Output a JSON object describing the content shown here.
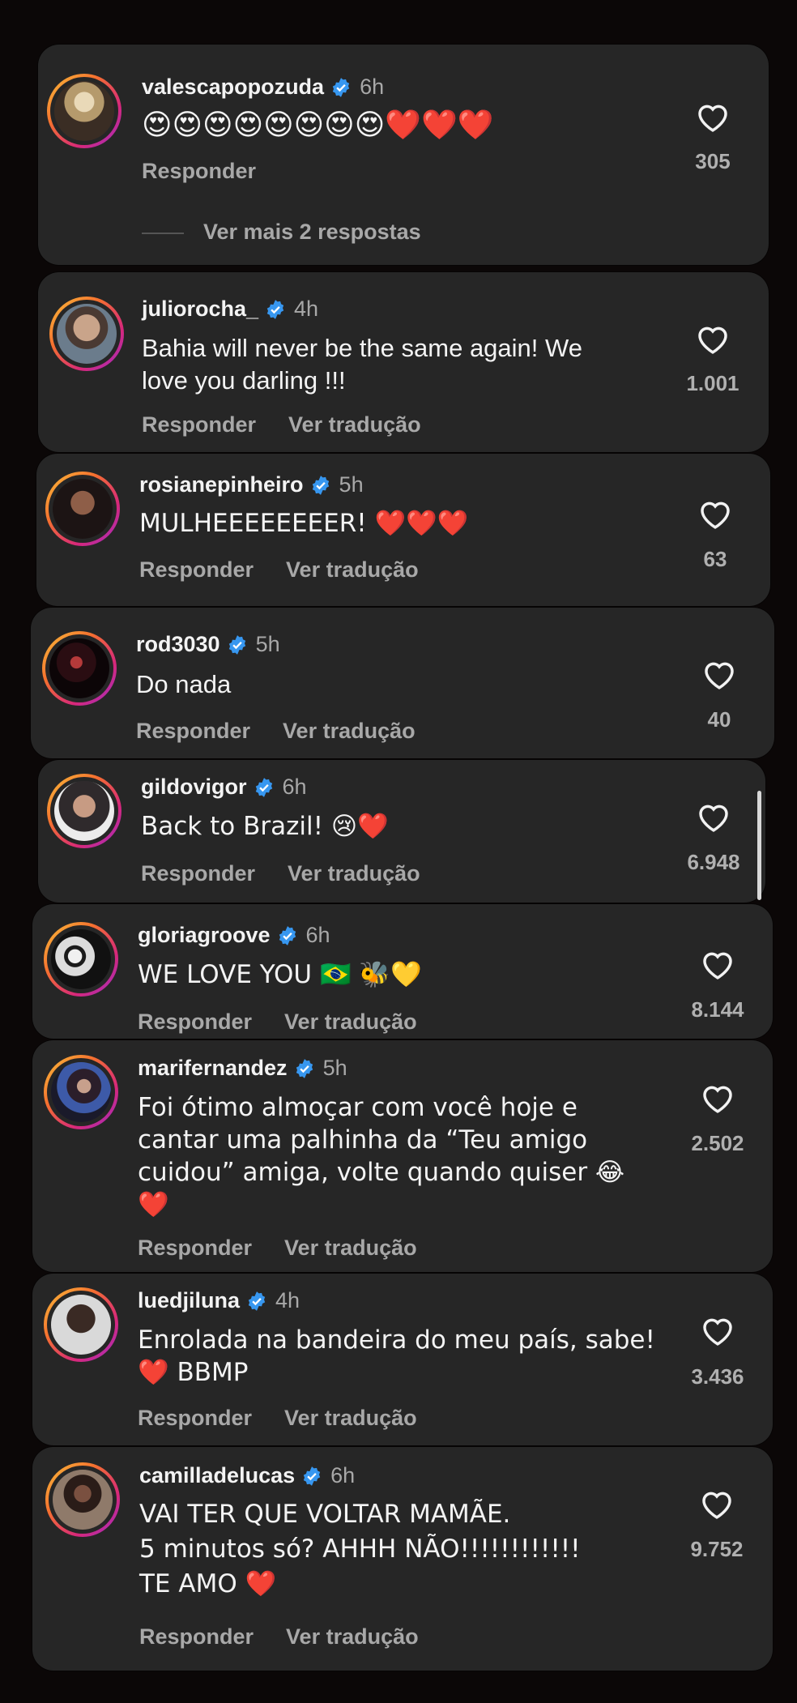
{
  "actions": {
    "reply": "Responder",
    "translate": "Ver tradução"
  },
  "comments": [
    {
      "username": "valescapopozuda",
      "time": "6h",
      "lines": [
        "😍😍😍😍😍😍😍😍❤️❤️❤️"
      ],
      "likes": "305",
      "more_replies": "Ver mais 2 respostas"
    },
    {
      "username": "juliorocha_",
      "time": "4h",
      "lines": [
        "Bahia will never be the same again! We",
        "love you darling !!!"
      ],
      "likes": "1.001"
    },
    {
      "username": "rosianepinheiro",
      "time": "5h",
      "lines": [
        "MULHEEEEEEEER! ❤️❤️❤️"
      ],
      "likes": "63"
    },
    {
      "username": "rod3030",
      "time": "5h",
      "lines": [
        "Do nada"
      ],
      "likes": "40"
    },
    {
      "username": "gildovigor",
      "time": "6h",
      "lines": [
        "Back to Brazil! 😢❤️"
      ],
      "likes": "6.948"
    },
    {
      "username": "gloriagroove",
      "time": "6h",
      "lines": [
        "WE LOVE YOU 🇧🇷 🐝💛"
      ],
      "likes": "8.144"
    },
    {
      "username": "marifernandez",
      "time": "5h",
      "lines": [
        "Foi ótimo almoçar com você hoje e",
        "cantar uma palhinha da “Teu amigo",
        "cuidou” amiga, volte quando quiser 😂",
        "❤️"
      ],
      "likes": "2.502"
    },
    {
      "username": "luedjiluna",
      "time": "4h",
      "lines": [
        "Enrolada na bandeira do meu país, sabe!",
        "❤️ BBMP"
      ],
      "likes": "3.436"
    },
    {
      "username": "camilladelucas",
      "time": "6h",
      "lines": [
        "VAI TER QUE VOLTAR MAMÃE.",
        "5 minutos só? AHHH NÃO!!!!!!!!!!!!",
        "TE AMO ❤️"
      ],
      "likes": "9.752"
    }
  ],
  "colors": {
    "card": "#262626",
    "background": "#0b0707",
    "verified": "#3797f0",
    "muted": "#a8a8a8"
  }
}
